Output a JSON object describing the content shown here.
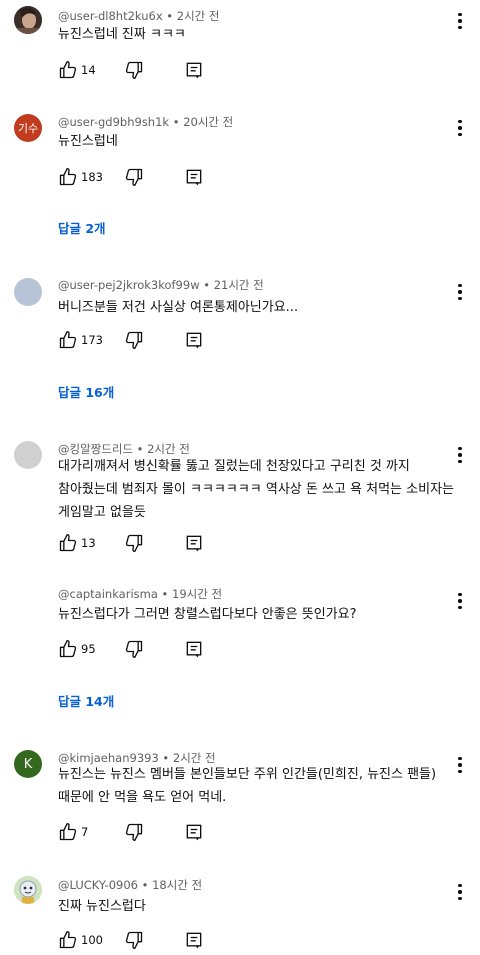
{
  "comments": [
    {
      "author": "@user-dl8ht2ku6x",
      "time": "2시간 전",
      "text": [
        "뉴진스럽네 진짜 ㅋㅋㅋ"
      ],
      "likes": "14",
      "avatar_type": "photo"
    },
    {
      "author": "@user-gd9bh9sh1k",
      "time": "20시간 전",
      "text": [
        "뉴진스럽네"
      ],
      "likes": "183",
      "avatar_text": "기수",
      "avatar_color": "#c13b1e",
      "replies": "답글 2개"
    },
    {
      "author": "@user-pej2jkrok3kof99w",
      "time": "21시간 전",
      "text": [
        "버니즈분들 저건 사실상 여론통제아닌가요..."
      ],
      "likes": "173",
      "avatar_color": "#b7c3d6",
      "replies": "답글 16개"
    },
    {
      "author": "@킹알짱드리드",
      "time": "2시간 전",
      "text": [
        "대가리깨져서 병신확률 뚫고 질렀는데 천장있다고 구리친 것 까지",
        "참아줬는데 범죄자 몰이 ㅋㅋㅋㅋㅋㅋ 역사상 돈 쓰고 욕 처먹는 소비자는",
        "게임말고 없을듯"
      ],
      "likes": "13",
      "avatar_color": "#d0d0d0"
    },
    {
      "author": "@captainkarisma",
      "time": "19시간 전",
      "text": [
        "뉴진스럽다가 그러면 창렬스럽다보다 안좋은 뜻인가요?"
      ],
      "likes": "95",
      "replies": "답글 14개"
    },
    {
      "author": "@kimjaehan9393",
      "time": "2시간 전",
      "text": [
        "뉴진스는 뉴진스 멤버들 본인들보단 주위 인간들(민희진, 뉴진스 팬들)",
        "때문에 안 먹을 욕도 얻어 먹네."
      ],
      "likes": "7",
      "avatar_text": "K",
      "avatar_color": "#33691e"
    },
    {
      "author": "@LUCKY-0906",
      "time": "18시간 전",
      "text": [
        "진짜 뉴진스럽다"
      ],
      "likes": "100",
      "avatar_type": "cartoon"
    }
  ],
  "separator": " • ",
  "icons": {
    "like": "thumb-up-icon",
    "dislike": "thumb-down-icon",
    "reply": "reply-icon",
    "more": "more-vert-icon"
  }
}
